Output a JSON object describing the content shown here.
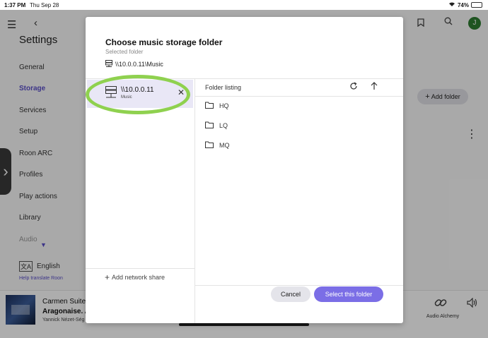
{
  "status_bar": {
    "time": "1:37 PM",
    "date": "Thu Sep 28",
    "battery": "74%",
    "battery_level": 0.74
  },
  "settings": {
    "title": "Settings",
    "nav": [
      "General",
      "Storage",
      "Services",
      "Setup",
      "Roon ARC",
      "Profiles",
      "Play actions",
      "Library",
      "Audio"
    ],
    "active": "Storage",
    "language": "English",
    "help_link": "Help translate Roon",
    "add_folder": "Add folder",
    "avatar_letter": "J"
  },
  "now_playing": {
    "title": "Carmen Suite",
    "subtitle": "Aragonaise. A",
    "artist": "Yannick Nézet-Ség",
    "zone": "Audio Alchemy"
  },
  "modal": {
    "title": "Choose music storage folder",
    "selected_label": "Selected folder",
    "selected_path": "\\\\10.0.0.11\\Music",
    "shares": [
      {
        "name": "\\\\10.0.0.11",
        "sub": "Music"
      }
    ],
    "add_share": "Add network share",
    "listing_header": "Folder listing",
    "folders": [
      "HQ",
      "LQ",
      "MQ"
    ],
    "cancel": "Cancel",
    "select": "Select this folder"
  },
  "colors": {
    "accent": "#5a4ec9",
    "primary_button": "#7b6ee6",
    "highlight": "#8fd14f"
  }
}
